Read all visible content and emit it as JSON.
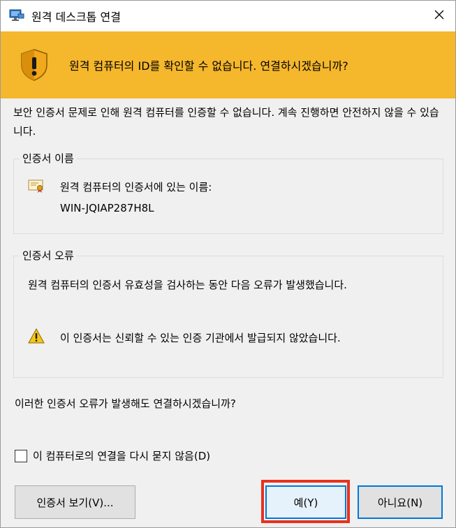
{
  "window": {
    "title": "원격 데스크톱 연결",
    "close_glyph": "✕"
  },
  "banner": {
    "text": "원격 컴퓨터의 ID를 확인할 수 없습니다. 연결하시겠습니까?",
    "color": "#f5b72b"
  },
  "intro": {
    "text": "보안 인증서 문제로 인해 원격 컴퓨터를 인증할 수 없습니다. 계속 진행하면 안전하지 않을 수 있습니다."
  },
  "cert_name_group": {
    "legend": "인증서 이름",
    "label": "원격 컴퓨터의 인증서에 있는 이름:",
    "value": "WIN-JQIAP287H8L"
  },
  "cert_error_group": {
    "legend": "인증서 오류",
    "description": "원격 컴퓨터의 인증서 유효성을 검사하는 동안 다음 오류가 발생했습니다.",
    "warning": "이 인증서는 신뢰할 수 있는 인증 기관에서 발급되지 않았습니다."
  },
  "question": "이러한 인증서 오류가 발생해도 연결하시겠습니까?",
  "checkbox": {
    "label": "이 컴퓨터로의 연결을 다시 묻지 않음(D)",
    "checked": false
  },
  "buttons": {
    "view_cert": "인증서 보기(V)...",
    "yes": "예(Y)",
    "no": "아니요(N)"
  },
  "highlight_color": "#e8311d"
}
